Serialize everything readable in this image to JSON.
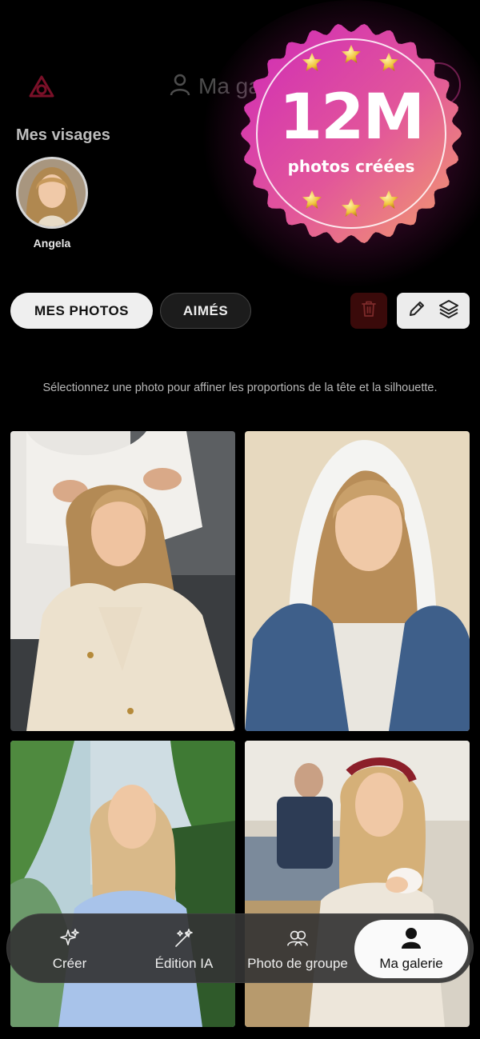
{
  "header": {
    "title": "Ma ga",
    "logo_icon": "app-logo-icon",
    "user_icon": "user-icon"
  },
  "promo": {
    "headline": "12M",
    "subtitle": "photos créées",
    "star_count": 6,
    "colors": {
      "start": "#d62fb5",
      "end": "#f09a6e"
    }
  },
  "faces": {
    "section_title": "Mes visages",
    "items": [
      {
        "name": "Angela"
      }
    ]
  },
  "tabs": {
    "mine": "MES PHOTOS",
    "liked": "AIMÉS"
  },
  "toolbar": {
    "delete_icon": "trash-icon",
    "edit_icon": "pencil-icon",
    "layers_icon": "layers-icon"
  },
  "hint": "Sélectionnez une photo pour affiner les proportions de la tête et la silhouette.",
  "photos": [
    {
      "id": "salon"
    },
    {
      "id": "hoodie"
    },
    {
      "id": "garden"
    },
    {
      "id": "cafe"
    }
  ],
  "nav": {
    "items": [
      {
        "label": "Créer",
        "icon": "sparkles-icon"
      },
      {
        "label": "Édition IA",
        "icon": "magic-wand-icon"
      },
      {
        "label": "Photo de groupe",
        "icon": "group-icon"
      },
      {
        "label": "Ma galerie",
        "icon": "person-icon"
      }
    ],
    "active_index": 3
  }
}
